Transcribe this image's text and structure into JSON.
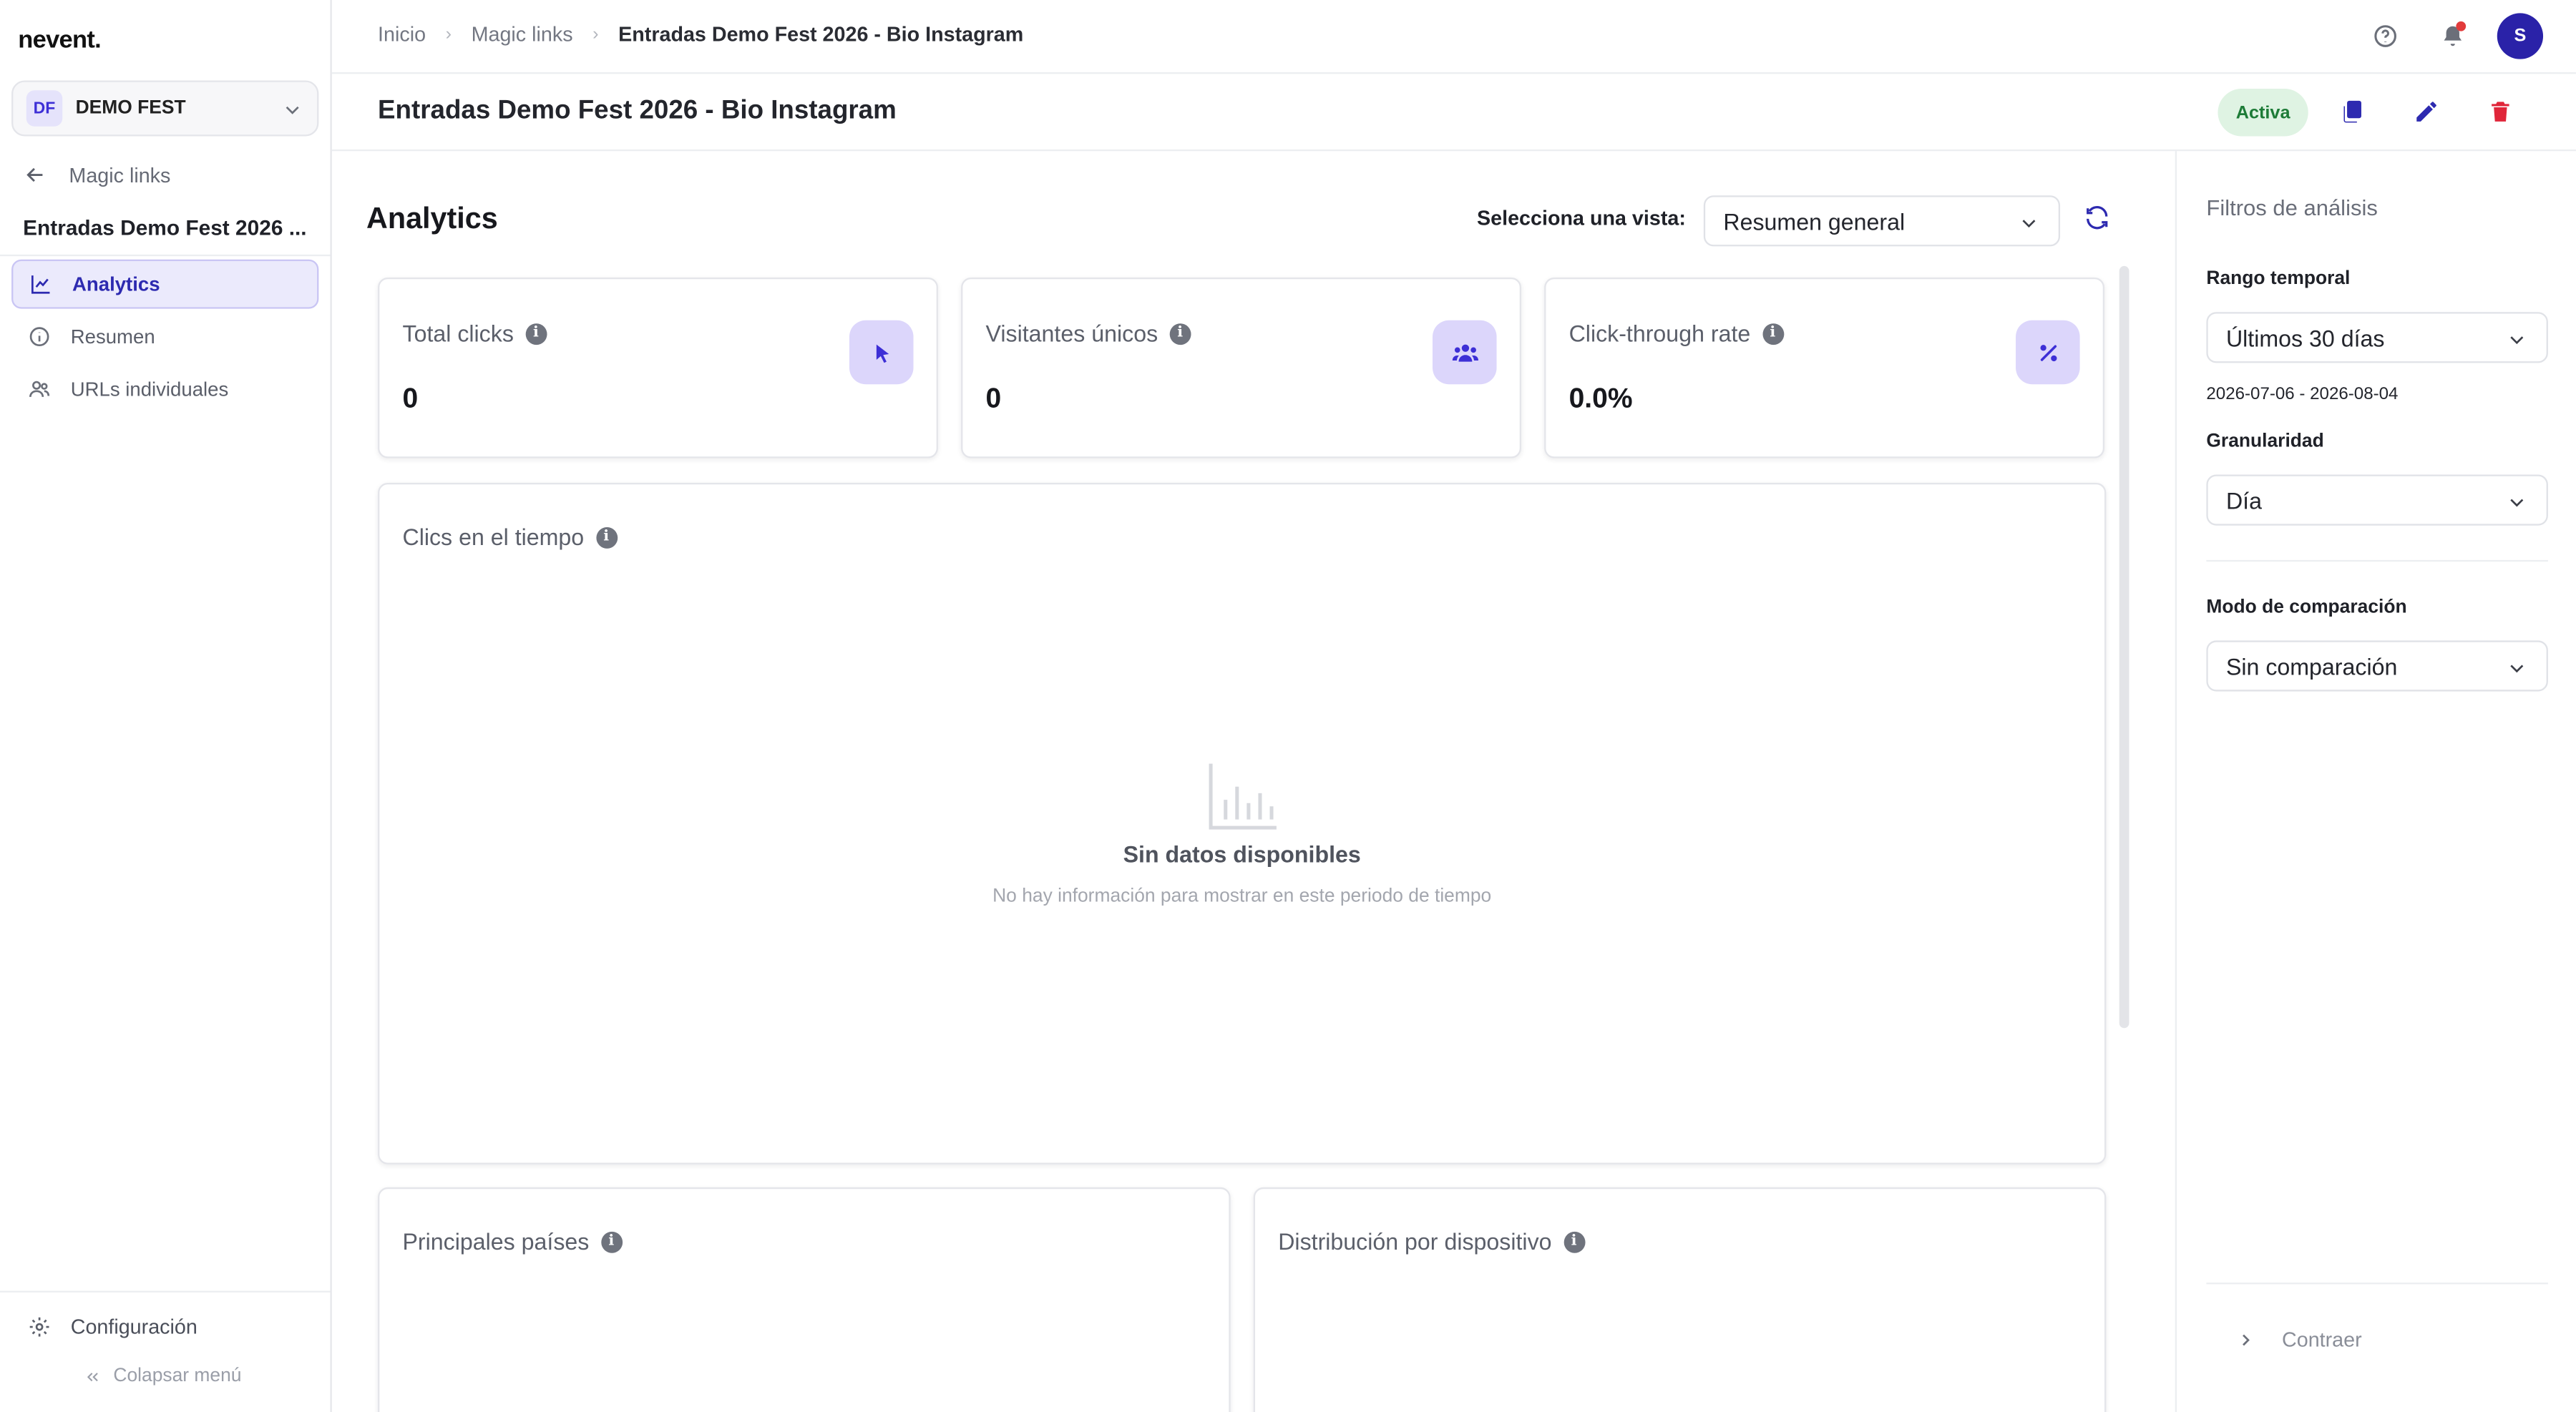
{
  "app": {
    "logo": "nevent."
  },
  "org": {
    "badge": "DF",
    "name": "DEMO FEST"
  },
  "sidebar": {
    "back_label": "Magic links",
    "link_title": "Entradas Demo Fest 2026 ...",
    "items": [
      {
        "label": "Analytics",
        "icon": "chart-line-icon",
        "active": true
      },
      {
        "label": "Resumen",
        "icon": "info-circle-icon",
        "active": false
      },
      {
        "label": "URLs individuales",
        "icon": "users-icon",
        "active": false
      }
    ],
    "config_label": "Configuración",
    "collapse_label": "Colapsar menú"
  },
  "header": {
    "breadcrumbs": [
      "Inicio",
      "Magic links",
      "Entradas Demo Fest 2026 - Bio Instagram"
    ],
    "avatar_initial": "S",
    "page_title": "Entradas Demo Fest 2026 - Bio Instagram",
    "status": "Activa"
  },
  "main": {
    "title": "Analytics",
    "view_label": "Selecciona una vista:",
    "view_selected": "Resumen general",
    "stats": [
      {
        "title": "Total clicks",
        "value": "0",
        "icon": "cursor-icon"
      },
      {
        "title": "Visitantes únicos",
        "value": "0",
        "icon": "users-icon"
      },
      {
        "title": "Click-through rate",
        "value": "0.0%",
        "icon": "percent-icon"
      }
    ],
    "timeline": {
      "title": "Clics en el tiempo",
      "empty_title": "Sin datos disponibles",
      "empty_sub": "No hay información para mostrar en este periodo de tiempo"
    },
    "countries_title": "Principales países",
    "devices_title": "Distribución por dispositivo"
  },
  "filters": {
    "title": "Filtros de análisis",
    "range_label": "Rango temporal",
    "range_value": "Últimos 30 días",
    "range_dates": "2026-07-06 - 2026-08-04",
    "granularity_label": "Granularidad",
    "granularity_value": "Día",
    "compare_label": "Modo de comparación",
    "compare_value": "Sin comparación",
    "collapse_label": "Contraer"
  },
  "colors": {
    "accent": "#2d2ab0",
    "status_bg": "#dff3e3",
    "danger": "#e0263a"
  }
}
